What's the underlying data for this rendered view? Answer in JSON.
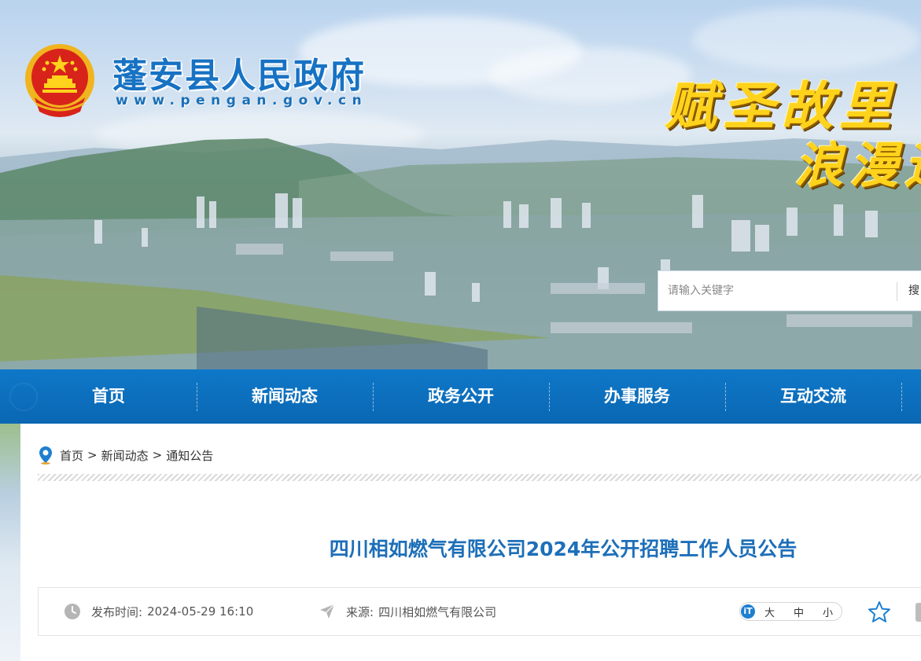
{
  "header": {
    "site_title": "蓬安县人民政府",
    "site_url": "www.pengan.gov.cn",
    "slogan_line1": "赋圣故里",
    "slogan_line2": "浪漫运"
  },
  "search": {
    "placeholder": "请输入关键字",
    "button_label": "搜"
  },
  "nav": {
    "items": [
      {
        "label": "首页"
      },
      {
        "label": "新闻动态"
      },
      {
        "label": "政务公开"
      },
      {
        "label": "办事服务"
      },
      {
        "label": "互动交流"
      }
    ]
  },
  "breadcrumb": {
    "items": [
      "首页",
      "新闻动态",
      "通知公告"
    ],
    "separator": ">"
  },
  "article": {
    "title": "四川相如燃气有限公司2024年公开招聘工作人员公告",
    "publish_label": "发布时间:",
    "publish_time": "2024-05-29 16:10",
    "source_label": "来源:",
    "source": "四川相如燃气有限公司"
  },
  "font_size": {
    "icon_text": "iT",
    "large": "大",
    "medium": "中",
    "small": "小"
  },
  "colors": {
    "brand_blue": "#0b6fbe",
    "title_blue": "#1d6fb8",
    "slogan_gold": "#ffd21c"
  }
}
